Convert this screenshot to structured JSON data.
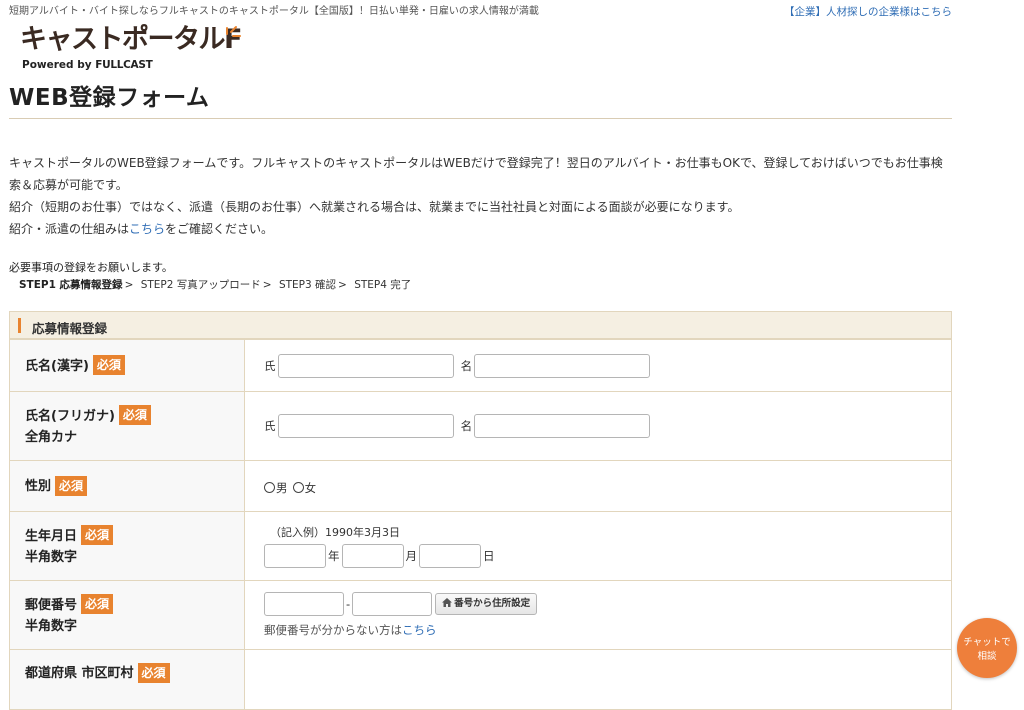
{
  "header": {
    "tagline": "短期アルバイト・バイト探しならフルキャストのキャストポータル【全国版】！日払い単発・日雇いの求人情報が満載",
    "corp_link": "【企業】人材探しの企業様はこちら",
    "logo_text": "キャストポータル",
    "logo_f": "F",
    "logo_powered_by": "Powered by ",
    "logo_brand": "FULLCAST"
  },
  "page_title": "WEB登録フォーム",
  "intro": {
    "line1": "キャストポータルのWEB登録フォームです。フルキャストのキャストポータルはWEBだけで登録完了！翌日のアルバイト・お仕事もOKで、登録しておけばいつでもお仕事検索＆応募が可能です。",
    "line2": "紹介（短期のお仕事）ではなく、派遣（長期のお仕事）へ就業される場合は、就業までに当社社員と対面による面談が必要になります。",
    "line3_pre": "紹介・派遣の仕組みは",
    "line3_link": "こちら",
    "line3_post": "をご確認ください。"
  },
  "request_text": "必要事項の登録をお願いします。",
  "steps": [
    {
      "label": "STEP1 応募情報登録",
      "active": true
    },
    {
      "label": "STEP2 写真アップロード",
      "active": false
    },
    {
      "label": "STEP3 確認",
      "active": false
    },
    {
      "label": "STEP4 完了",
      "active": false
    }
  ],
  "step_separator": ">",
  "form": {
    "section_title": "応募情報登録",
    "required_badge": "必須",
    "rows": {
      "name_kanji": {
        "label": "氏名(漢字)",
        "last_prefix": "氏",
        "first_prefix": "名"
      },
      "name_kana": {
        "label": "氏名(フリガナ)",
        "sub": "全角カナ",
        "last_prefix": "氏",
        "first_prefix": "名"
      },
      "gender": {
        "label": "性別",
        "options": [
          "男",
          "女"
        ]
      },
      "birthdate": {
        "label": "生年月日",
        "sub": "半角数字",
        "example": "（記入例）1990年3月3日",
        "year": "年",
        "month": "月",
        "day": "日"
      },
      "postal": {
        "label": "郵便番号",
        "sub": "半角数字",
        "dash": "-",
        "button": "番号から住所設定",
        "note_pre": "郵便番号が分からない方は",
        "note_link": "こちら"
      },
      "prefecture": {
        "label": "都道府県 市区町村"
      }
    }
  },
  "chat": {
    "line1": "チャットで",
    "line2": "相談"
  },
  "colors": {
    "accent": "#e8832f",
    "link": "#2f6db5",
    "section_bg": "#f5efe2",
    "border": "#e2d6bd"
  }
}
